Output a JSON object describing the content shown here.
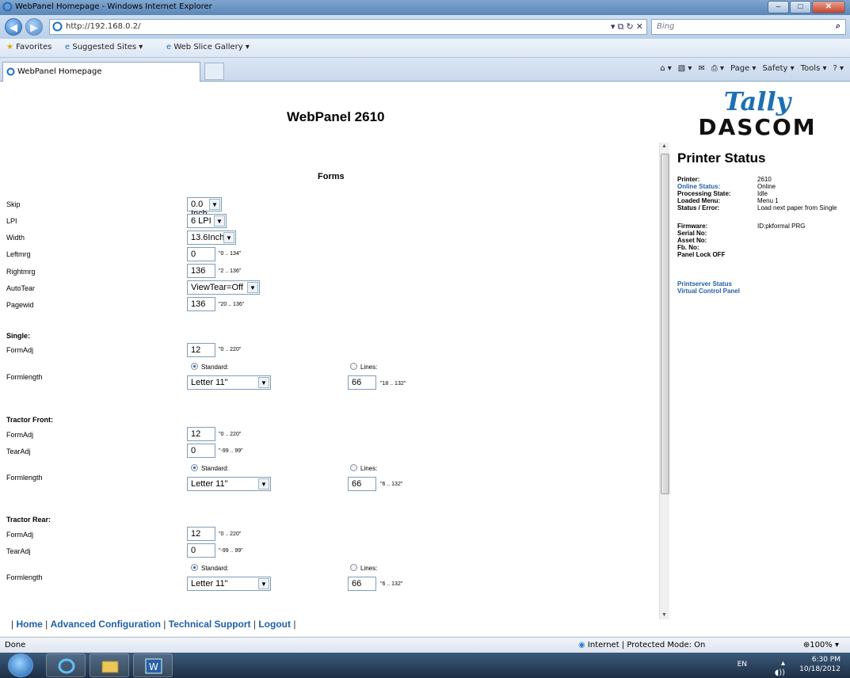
{
  "window": {
    "title": "WebPanel Homepage - Windows Internet Explorer"
  },
  "address": {
    "url": "http://192.168.0.2/",
    "search_placeholder": "Bing"
  },
  "favorites": {
    "favorites_label": "Favorites",
    "suggested": "Suggested Sites ▾",
    "gallery": "Web Slice Gallery ▾"
  },
  "tab": {
    "label": "WebPanel Homepage"
  },
  "commandbar": {
    "page": "Page ▾",
    "safety": "Safety ▾",
    "tools": "Tools ▾"
  },
  "page": {
    "heading": "WebPanel 2610",
    "logo_top": "Tally",
    "logo_bottom": "DASCOM"
  },
  "forms": {
    "title": "Forms",
    "fields": {
      "skip": {
        "label": "Skip",
        "value": "0.0 Inch"
      },
      "lpi": {
        "label": "LPI",
        "value": "6 LPI"
      },
      "width": {
        "label": "Width",
        "value": "13.6Inch"
      },
      "leftmrg": {
        "label": "Leftmrg",
        "value": "0",
        "hint": "\"0 .. 134\""
      },
      "rightmrg": {
        "label": "Rightmrg",
        "value": "136",
        "hint": "\"2 .. 136\""
      },
      "autotear": {
        "label": "AutoTear",
        "value": "ViewTear=Off"
      },
      "pagewid": {
        "label": "Pagewid",
        "value": "136",
        "hint": "\"20 .. 136\""
      }
    },
    "single": {
      "title": "Single:",
      "formadj_label": "FormAdj",
      "formadj_value": "12",
      "formadj_hint": "\"0 .. 220\"",
      "formlength_label": "Formlength",
      "standard_label": "Standard:",
      "standard_value": "Letter 11\"",
      "lines_label": "Lines:",
      "lines_value": "66",
      "lines_hint": "\"18 .. 132\""
    },
    "tractor_front": {
      "title": "Tractor Front:",
      "formadj_label": "FormAdj",
      "formadj_value": "12",
      "formadj_hint": "\"0 .. 220\"",
      "tearadj_label": "TearAdj",
      "tearadj_value": "0",
      "tearadj_hint": "\"-99 .. 99\"",
      "formlength_label": "Formlength",
      "standard_label": "Standard:",
      "standard_value": "Letter 11\"",
      "lines_label": "Lines:",
      "lines_value": "66",
      "lines_hint": "\"6 .. 132\""
    },
    "tractor_rear": {
      "title": "Tractor Rear:",
      "formadj_label": "FormAdj",
      "formadj_value": "12",
      "formadj_hint": "\"0 .. 220\"",
      "tearadj_label": "TearAdj",
      "tearadj_value": "0",
      "tearadj_hint": "\"-99 .. 99\"",
      "formlength_label": "Formlength",
      "standard_label": "Standard:",
      "standard_value": "Letter 11\"",
      "lines_label": "Lines:",
      "lines_value": "66",
      "lines_hint": "\"6 .. 132\""
    }
  },
  "status": {
    "title": "Printer Status",
    "printer_k": "Printer:",
    "printer_v": "2610",
    "online_k": "Online Status:",
    "online_v": "Online",
    "proc_k": "Processing State:",
    "proc_v": "Idle",
    "menu_k": "Loaded Menu:",
    "menu_v": "Menu 1",
    "err_k": "Status / Error:",
    "err_v": "Load next paper from Single",
    "fw_k": "Firmware:",
    "fw_v": "ID:pkformal PRG",
    "serial_k": "Serial No:",
    "asset_k": "Asset No:",
    "fb_k": "Fb. No:",
    "lock": "Panel Lock OFF",
    "link_ps": "Printserver Status",
    "link_vcp": "Virtual Control Panel"
  },
  "footer": {
    "home": "Home",
    "adv": "Advanced Configuration",
    "tech": "Technical Support",
    "logout": "Logout"
  },
  "statusbar": {
    "left": "Done",
    "zone": "Internet | Protected Mode: On",
    "zoom": "100%"
  },
  "taskbar": {
    "lang": "EN",
    "time": "6:30 PM",
    "date": "10/18/2012"
  },
  "colors": {
    "link": "#1f5fa8",
    "title_bar": "#6f98c6"
  }
}
